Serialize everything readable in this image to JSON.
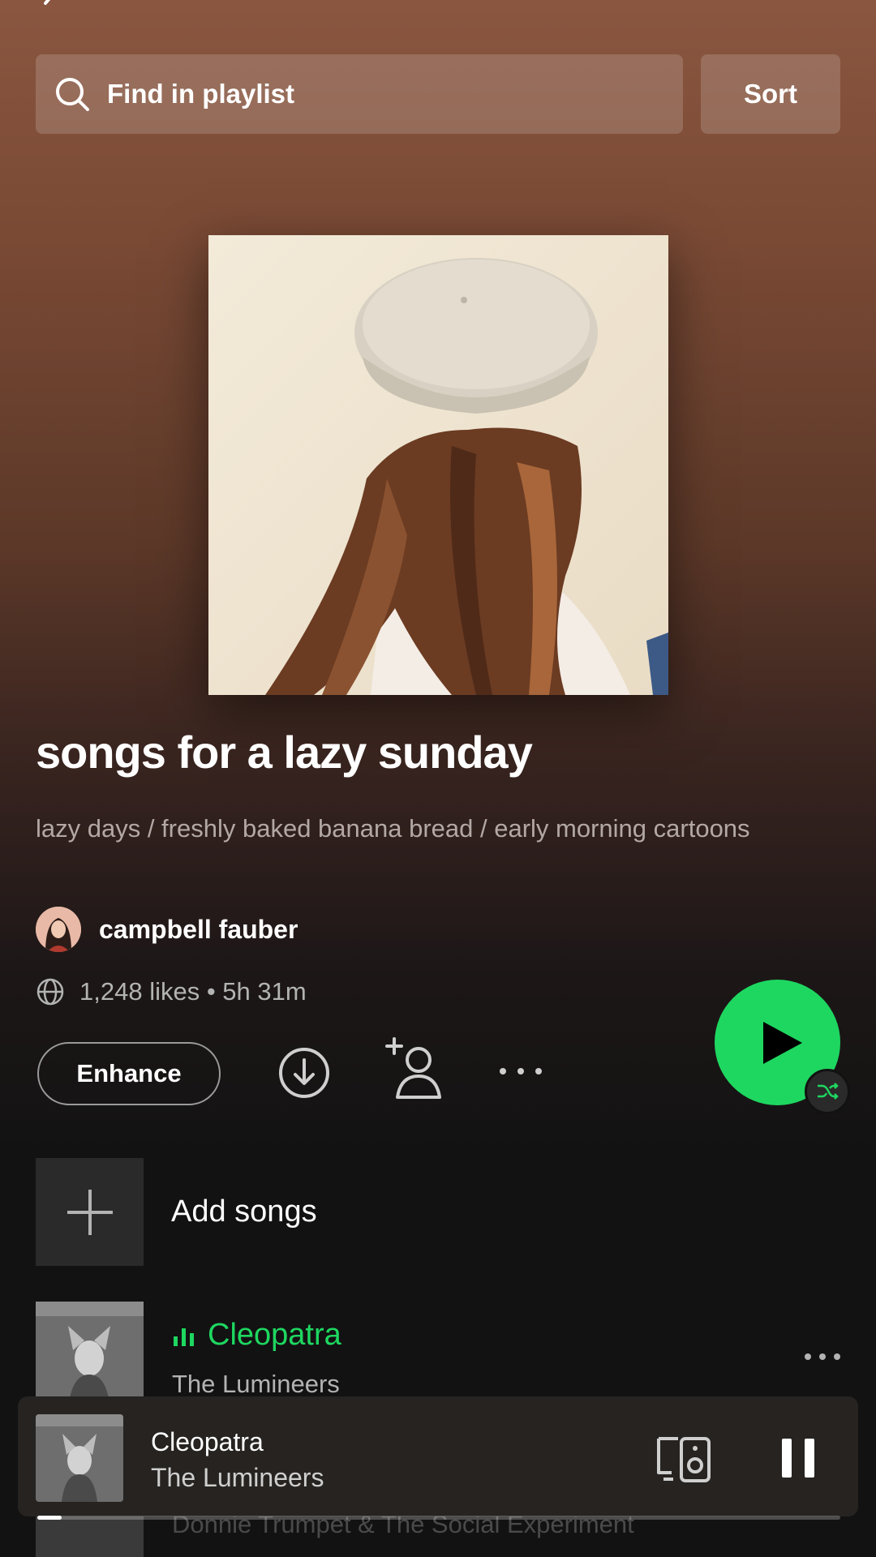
{
  "search": {
    "placeholder": "Find in playlist"
  },
  "sort": {
    "label": "Sort"
  },
  "playlist": {
    "title": "songs for a lazy sunday",
    "description": "lazy days / freshly baked banana bread / early morning cartoons",
    "owner": "campbell fauber",
    "meta": "1,248 likes • 5h 31m"
  },
  "actions": {
    "enhance_label": "Enhance"
  },
  "add_songs": {
    "label": "Add songs"
  },
  "tracks": [
    {
      "title": "Cleopatra",
      "artist": "The Lumineers",
      "playing": true
    }
  ],
  "faded_next": {
    "artist": "Donnie Trumpet & The Social Experiment"
  },
  "now_playing": {
    "title": "Cleopatra",
    "artist": "The Lumineers",
    "progress": 0.03
  },
  "colors": {
    "accent": "#1ed760",
    "background": "#121212",
    "header_tint": "#8a5640"
  },
  "icons": {
    "back": "chevron-left-icon",
    "search": "search-icon",
    "globe": "globe-icon",
    "download": "download-icon",
    "add_user": "add-user-icon",
    "more": "more-icon",
    "play": "play-icon",
    "shuffle": "shuffle-icon",
    "plus": "plus-icon",
    "equalizer": "equalizer-icon",
    "devices": "devices-icon",
    "pause": "pause-icon"
  }
}
